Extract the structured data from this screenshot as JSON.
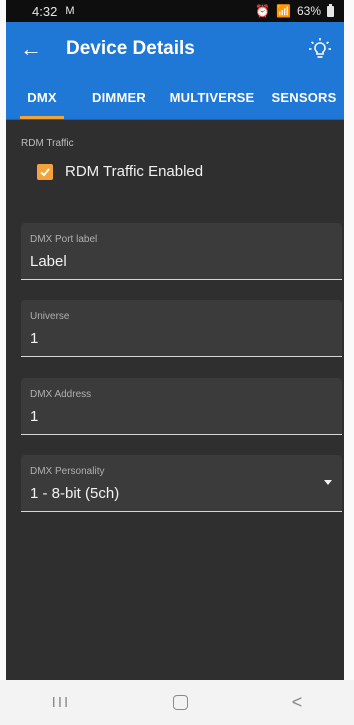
{
  "status_bar": {
    "time": "4:32",
    "messenger_glyph": "M",
    "signal_text": "⌁",
    "battery_percent": "63%"
  },
  "app_bar": {
    "title": "Device Details",
    "back_icon": "arrow-left-icon",
    "action_icon": "lightbulb-icon"
  },
  "tabs": [
    {
      "label": "DMX",
      "active": true
    },
    {
      "label": "DIMMER",
      "active": false
    },
    {
      "label": "MULTIVERSE",
      "active": false
    },
    {
      "label": "SENSORS",
      "active": false
    }
  ],
  "rdm": {
    "section_label": "RDM Traffic",
    "checkbox_label": "RDM Traffic Enabled",
    "checked": true,
    "accent_color": "#f4a33b"
  },
  "fields": {
    "port_label": {
      "label": "DMX Port label",
      "value": "Label"
    },
    "universe": {
      "label": "Universe",
      "value": "1"
    },
    "address": {
      "label": "DMX Address",
      "value": "1"
    },
    "personality": {
      "label": "DMX Personality",
      "value": "1 - 8-bit (5ch)"
    }
  },
  "colors": {
    "app_bar": "#1f77d6",
    "tab_indicator": "#f0a33a",
    "background": "#2f2f2f"
  },
  "nav_bar": {
    "recent": "III",
    "back": "<"
  }
}
